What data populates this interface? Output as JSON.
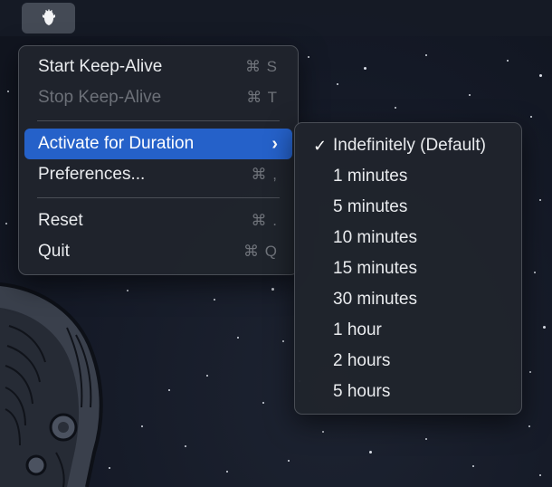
{
  "menubar": {
    "status_item_icon": "keep-alive-app-icon"
  },
  "main_menu": {
    "items": [
      {
        "label": "Start Keep-Alive",
        "shortcut": "⌘ S",
        "enabled": true
      },
      {
        "label": "Stop Keep-Alive",
        "shortcut": "⌘ T",
        "enabled": false
      },
      {
        "label": "Activate for Duration",
        "submenu_indicator": "›",
        "highlighted": true
      },
      {
        "label": "Preferences...",
        "shortcut": "⌘ ,",
        "enabled": true
      },
      {
        "label": "Reset",
        "shortcut": "⌘ .",
        "enabled": true
      },
      {
        "label": "Quit",
        "shortcut": "⌘ Q",
        "enabled": true
      }
    ]
  },
  "duration_submenu": {
    "check_mark": "✓",
    "selected_index": 0,
    "items": [
      {
        "label": "Indefinitely (Default)"
      },
      {
        "label": "1 minutes"
      },
      {
        "label": "5 minutes"
      },
      {
        "label": "10 minutes"
      },
      {
        "label": "15 minutes"
      },
      {
        "label": "30 minutes"
      },
      {
        "label": "1 hour"
      },
      {
        "label": "2 hours"
      },
      {
        "label": "5 hours"
      }
    ]
  },
  "colors": {
    "highlight": "#2561c9",
    "menu_background": "#20242c",
    "wallpaper": "#161b26"
  }
}
